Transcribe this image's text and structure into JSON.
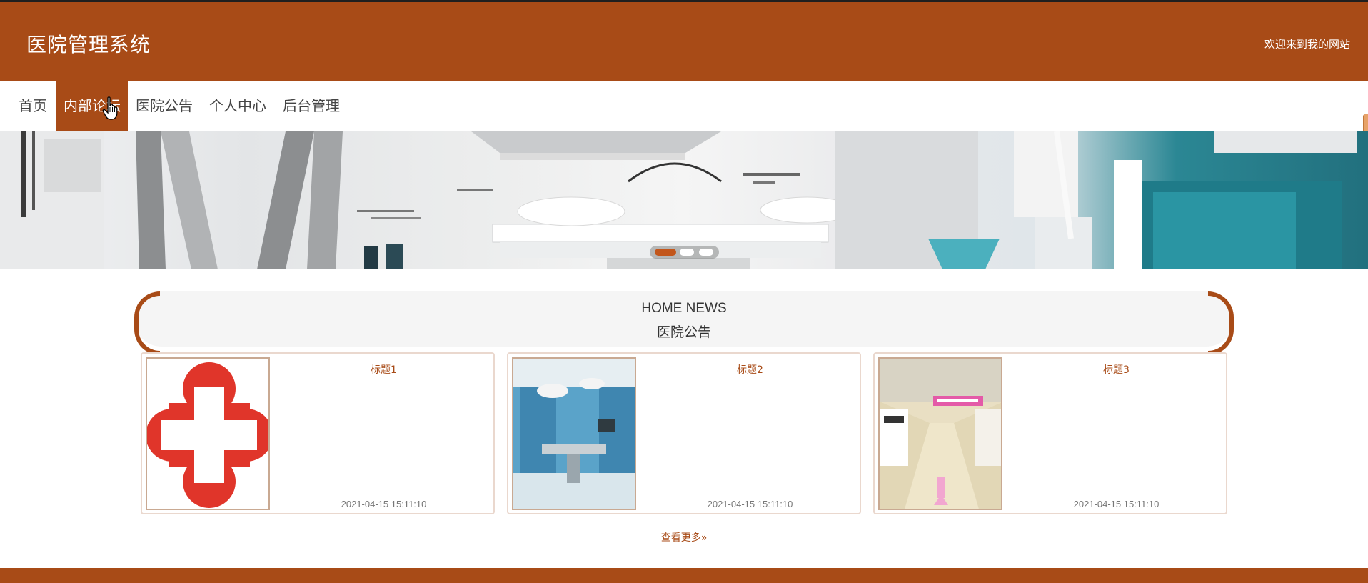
{
  "header": {
    "site_title": "医院管理系统",
    "welcome": "欢迎来到我的网站",
    "accent_color": "#a84b17"
  },
  "nav": {
    "items": [
      {
        "label": "首页"
      },
      {
        "label": "内部论坛",
        "active": true
      },
      {
        "label": "医院公告"
      },
      {
        "label": "个人中心"
      },
      {
        "label": "后台管理"
      }
    ]
  },
  "banner": {
    "slides": 3,
    "active_slide": 1
  },
  "section": {
    "title_en": "HOME NEWS",
    "title_cn": "医院公告"
  },
  "cards": [
    {
      "title": "标题1",
      "date": "2021-04-15 15:11:10",
      "image": "red-cross-logo"
    },
    {
      "title": "标题2",
      "date": "2021-04-15 15:11:10",
      "image": "operating-room-photo"
    },
    {
      "title": "标题3",
      "date": "2021-04-15 15:11:10",
      "image": "hospital-corridor-photo"
    }
  ],
  "more_link": "查看更多",
  "icons": {
    "more": "double-chevron-right-icon",
    "cursor": "hand-pointer-icon"
  }
}
